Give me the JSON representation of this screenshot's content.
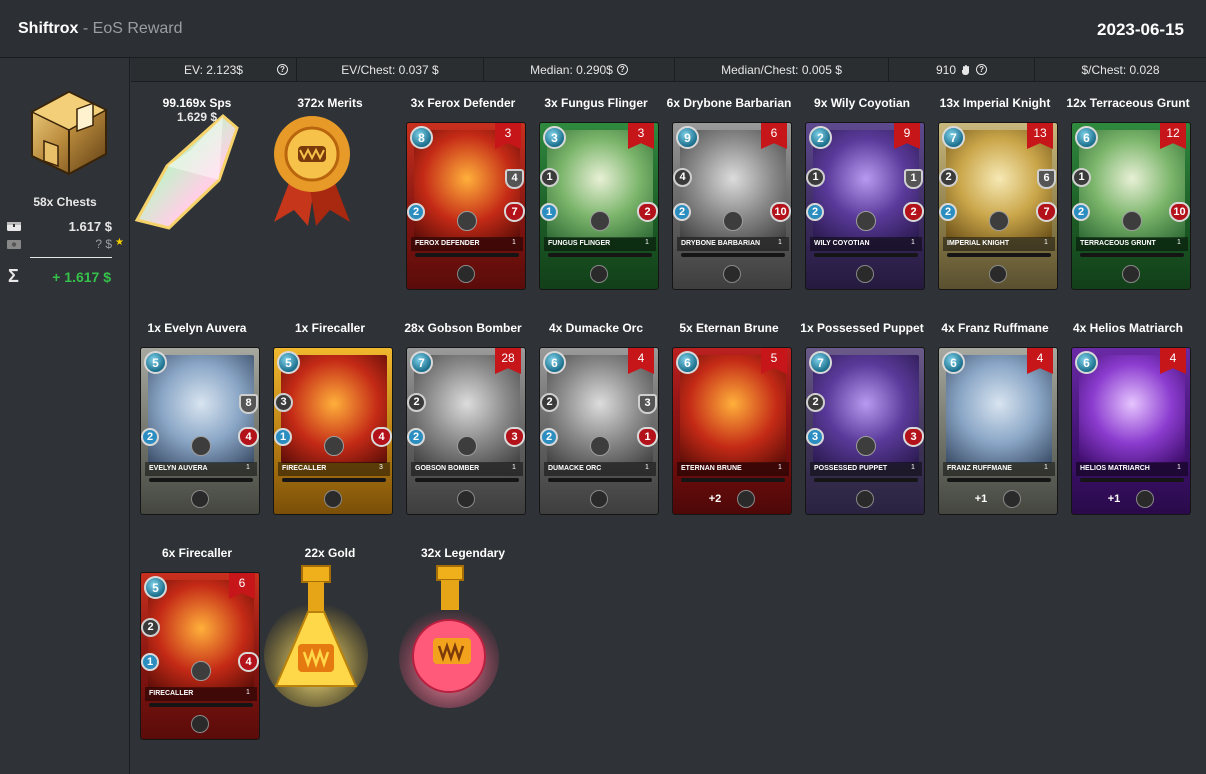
{
  "header": {
    "user": "Shiftrox",
    "subtitle": " - EoS Reward",
    "date": "2023-06-15"
  },
  "summary": {
    "chests_label": "58x Chests",
    "value_usd": "1.617 $",
    "unknown_usd": "? $",
    "star": "★",
    "sigma": "Σ",
    "total": "+ 1.617 $"
  },
  "stats": {
    "ev": "EV: 2.123$",
    "ev_chest": "EV/Chest: 0.037 $",
    "median": "Median: 0.290$",
    "median_chest": "Median/Chest: 0.005 $",
    "count": "910",
    "per_chest": "$/Chest: 0.028",
    "help": "?"
  },
  "rewards": [
    {
      "label": "99.169x Sps",
      "label2": "1.629 $",
      "kind": "sps"
    },
    {
      "label": "372x Merits",
      "kind": "merits"
    },
    {
      "label": "3x Ferox Defender",
      "kind": "card",
      "name": "Ferox Defender",
      "mana": "8",
      "count": "3",
      "atk": "",
      "spd": "2",
      "armor": "4",
      "hp": "7",
      "level": "1",
      "element": "fire"
    },
    {
      "label": "3x Fungus Flinger",
      "kind": "card",
      "name": "Fungus Flinger",
      "mana": "3",
      "count": "3",
      "atk": "1",
      "spd": "1",
      "armor": "",
      "hp": "2",
      "level": "1",
      "element": "earth"
    },
    {
      "label": "6x Drybone Barbarian",
      "kind": "card",
      "name": "Drybone Barbarian",
      "mana": "9",
      "count": "6",
      "atk": "4",
      "spd": "2",
      "armor": "",
      "hp": "10",
      "level": "1",
      "element": "neutral"
    },
    {
      "label": "9x Wily Coyotian",
      "kind": "card",
      "name": "Wily Coyotian",
      "mana": "2",
      "count": "9",
      "atk": "1",
      "spd": "2",
      "armor": "1",
      "hp": "2",
      "level": "1",
      "element": "death"
    },
    {
      "label": "13x Imperial Knight",
      "kind": "card",
      "name": "Imperial Knight",
      "mana": "7",
      "count": "13",
      "atk": "2",
      "spd": "2",
      "armor": "6",
      "hp": "7",
      "level": "1",
      "element": "life"
    },
    {
      "label": "12x Terraceous Grunt",
      "kind": "card",
      "name": "Terraceous Grunt",
      "mana": "6",
      "count": "12",
      "atk": "1",
      "spd": "2",
      "armor": "",
      "hp": "10",
      "level": "1",
      "element": "earth"
    },
    {
      "label": "1x Evelyn Auvera",
      "kind": "card",
      "name": "Evelyn Auvera",
      "mana": "5",
      "count": "",
      "atk": "",
      "spd": "2",
      "armor": "8",
      "hp": "4",
      "level": "1",
      "element": "lifegrey"
    },
    {
      "label": "1x Firecaller",
      "kind": "card",
      "name": "Firecaller",
      "mana": "5",
      "count": "",
      "atk": "3",
      "spd": "1",
      "armor": "",
      "hp": "4",
      "level": "3",
      "element": "gold"
    },
    {
      "label": "28x Gobson Bomber",
      "kind": "card",
      "name": "Gobson Bomber",
      "mana": "7",
      "count": "28",
      "atk": "2",
      "spd": "2",
      "armor": "",
      "hp": "3",
      "level": "1",
      "element": "neutral"
    },
    {
      "label": "4x Dumacke Orc",
      "kind": "card",
      "name": "Dumacke Orc",
      "mana": "6",
      "count": "4",
      "atk": "2",
      "spd": "2",
      "armor": "3",
      "hp": "1",
      "level": "1",
      "element": "neutral"
    },
    {
      "label": "5x Eternan Brune",
      "kind": "card",
      "name": "Eternan Brune",
      "mana": "6",
      "count": "5",
      "atk": "",
      "spd": "",
      "armor": "",
      "hp": "",
      "level": "1",
      "element": "darkred",
      "abil_txt": "+2"
    },
    {
      "label": "1x Possessed Puppet",
      "kind": "card",
      "name": "Possessed Puppet",
      "mana": "7",
      "count": "",
      "atk": "2",
      "spd": "3",
      "armor": "",
      "hp": "3",
      "level": "1",
      "element": "deathgrey"
    },
    {
      "label": "4x Franz Ruffmane",
      "kind": "card",
      "name": "Franz Ruffmane",
      "mana": "6",
      "count": "4",
      "atk": "",
      "spd": "",
      "armor": "",
      "hp": "",
      "level": "1",
      "element": "lifegrey",
      "abil_txt": "+1"
    },
    {
      "label": "4x Helios Matriarch",
      "kind": "card",
      "name": "Helios Matriarch",
      "mana": "6",
      "count": "4",
      "atk": "",
      "spd": "",
      "armor": "",
      "hp": "",
      "level": "1",
      "element": "purple",
      "abil_txt": "+1"
    },
    {
      "label": "6x Firecaller",
      "kind": "card",
      "name": "Firecaller",
      "mana": "5",
      "count": "6",
      "atk": "2",
      "spd": "1",
      "armor": "",
      "hp": "4",
      "level": "1",
      "element": "fire"
    },
    {
      "label": "22x Gold",
      "kind": "gold"
    },
    {
      "label": "32x Legendary",
      "kind": "legendary"
    }
  ]
}
